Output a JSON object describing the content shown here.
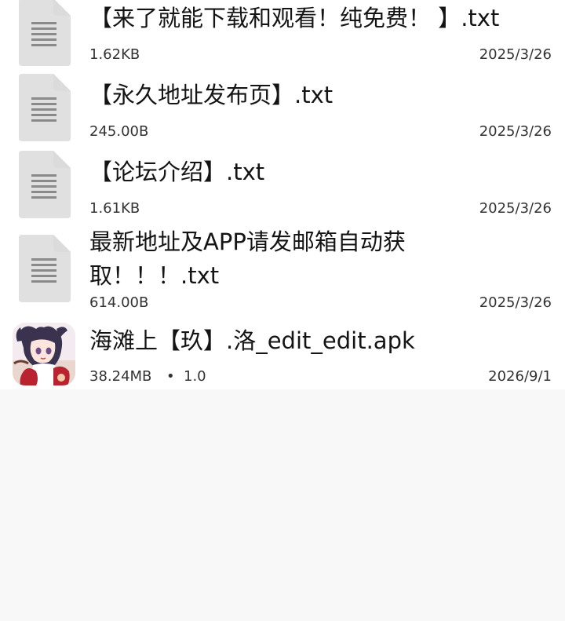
{
  "files": [
    {
      "name": "【来了就能下载和观看！纯免费！ 】.txt",
      "size": "1.62KB",
      "date": "2025/3/26",
      "icon": "text-file-icon"
    },
    {
      "name": "【永久地址发布页】.txt",
      "size": "245.00B",
      "date": "2025/3/26",
      "icon": "text-file-icon"
    },
    {
      "name": "【论坛介绍】.txt",
      "size": "1.61KB",
      "date": "2025/3/26",
      "icon": "text-file-icon"
    },
    {
      "name": "最新地址及APP请发邮箱自动获取！！！.txt",
      "size": "614.00B",
      "date": "2025/3/26",
      "icon": "text-file-icon"
    },
    {
      "name": "海滩上【玖】.洛_edit_edit.apk",
      "size": "38.24MB",
      "separator": "•",
      "version": "1.0",
      "date": "2026/9/1",
      "icon": "app-icon"
    }
  ],
  "colors": {
    "background": "#f8f8f8",
    "list_background": "#ffffff",
    "primary_text": "#141414",
    "secondary_text": "#333333",
    "doc_icon_fill": "#e0e0e0",
    "doc_icon_fold": "#ececec",
    "doc_icon_lines": "#8a8a8a"
  }
}
